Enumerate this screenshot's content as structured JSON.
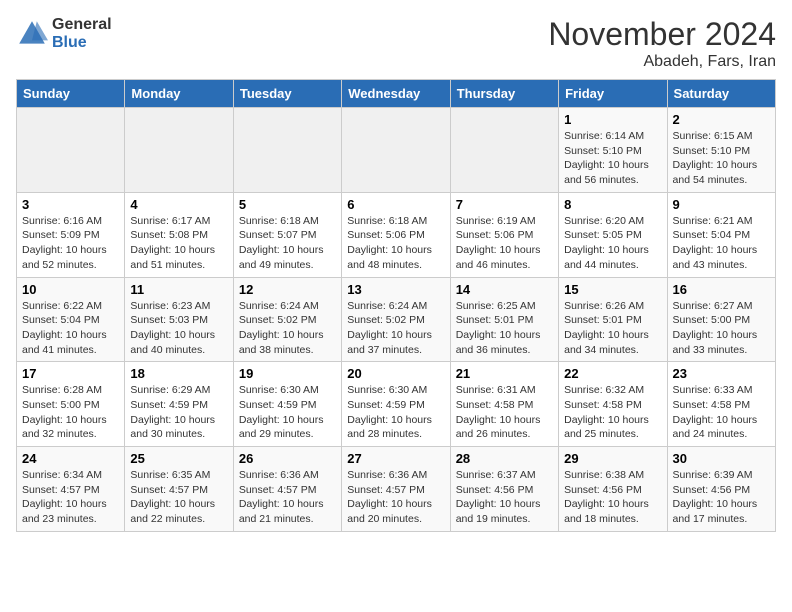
{
  "header": {
    "logo_general": "General",
    "logo_blue": "Blue",
    "month_title": "November 2024",
    "location": "Abadeh, Fars, Iran"
  },
  "days_of_week": [
    "Sunday",
    "Monday",
    "Tuesday",
    "Wednesday",
    "Thursday",
    "Friday",
    "Saturday"
  ],
  "weeks": [
    [
      {
        "day": "",
        "info": ""
      },
      {
        "day": "",
        "info": ""
      },
      {
        "day": "",
        "info": ""
      },
      {
        "day": "",
        "info": ""
      },
      {
        "day": "",
        "info": ""
      },
      {
        "day": "1",
        "info": "Sunrise: 6:14 AM\nSunset: 5:10 PM\nDaylight: 10 hours\nand 56 minutes."
      },
      {
        "day": "2",
        "info": "Sunrise: 6:15 AM\nSunset: 5:10 PM\nDaylight: 10 hours\nand 54 minutes."
      }
    ],
    [
      {
        "day": "3",
        "info": "Sunrise: 6:16 AM\nSunset: 5:09 PM\nDaylight: 10 hours\nand 52 minutes."
      },
      {
        "day": "4",
        "info": "Sunrise: 6:17 AM\nSunset: 5:08 PM\nDaylight: 10 hours\nand 51 minutes."
      },
      {
        "day": "5",
        "info": "Sunrise: 6:18 AM\nSunset: 5:07 PM\nDaylight: 10 hours\nand 49 minutes."
      },
      {
        "day": "6",
        "info": "Sunrise: 6:18 AM\nSunset: 5:06 PM\nDaylight: 10 hours\nand 48 minutes."
      },
      {
        "day": "7",
        "info": "Sunrise: 6:19 AM\nSunset: 5:06 PM\nDaylight: 10 hours\nand 46 minutes."
      },
      {
        "day": "8",
        "info": "Sunrise: 6:20 AM\nSunset: 5:05 PM\nDaylight: 10 hours\nand 44 minutes."
      },
      {
        "day": "9",
        "info": "Sunrise: 6:21 AM\nSunset: 5:04 PM\nDaylight: 10 hours\nand 43 minutes."
      }
    ],
    [
      {
        "day": "10",
        "info": "Sunrise: 6:22 AM\nSunset: 5:04 PM\nDaylight: 10 hours\nand 41 minutes."
      },
      {
        "day": "11",
        "info": "Sunrise: 6:23 AM\nSunset: 5:03 PM\nDaylight: 10 hours\nand 40 minutes."
      },
      {
        "day": "12",
        "info": "Sunrise: 6:24 AM\nSunset: 5:02 PM\nDaylight: 10 hours\nand 38 minutes."
      },
      {
        "day": "13",
        "info": "Sunrise: 6:24 AM\nSunset: 5:02 PM\nDaylight: 10 hours\nand 37 minutes."
      },
      {
        "day": "14",
        "info": "Sunrise: 6:25 AM\nSunset: 5:01 PM\nDaylight: 10 hours\nand 36 minutes."
      },
      {
        "day": "15",
        "info": "Sunrise: 6:26 AM\nSunset: 5:01 PM\nDaylight: 10 hours\nand 34 minutes."
      },
      {
        "day": "16",
        "info": "Sunrise: 6:27 AM\nSunset: 5:00 PM\nDaylight: 10 hours\nand 33 minutes."
      }
    ],
    [
      {
        "day": "17",
        "info": "Sunrise: 6:28 AM\nSunset: 5:00 PM\nDaylight: 10 hours\nand 32 minutes."
      },
      {
        "day": "18",
        "info": "Sunrise: 6:29 AM\nSunset: 4:59 PM\nDaylight: 10 hours\nand 30 minutes."
      },
      {
        "day": "19",
        "info": "Sunrise: 6:30 AM\nSunset: 4:59 PM\nDaylight: 10 hours\nand 29 minutes."
      },
      {
        "day": "20",
        "info": "Sunrise: 6:30 AM\nSunset: 4:59 PM\nDaylight: 10 hours\nand 28 minutes."
      },
      {
        "day": "21",
        "info": "Sunrise: 6:31 AM\nSunset: 4:58 PM\nDaylight: 10 hours\nand 26 minutes."
      },
      {
        "day": "22",
        "info": "Sunrise: 6:32 AM\nSunset: 4:58 PM\nDaylight: 10 hours\nand 25 minutes."
      },
      {
        "day": "23",
        "info": "Sunrise: 6:33 AM\nSunset: 4:58 PM\nDaylight: 10 hours\nand 24 minutes."
      }
    ],
    [
      {
        "day": "24",
        "info": "Sunrise: 6:34 AM\nSunset: 4:57 PM\nDaylight: 10 hours\nand 23 minutes."
      },
      {
        "day": "25",
        "info": "Sunrise: 6:35 AM\nSunset: 4:57 PM\nDaylight: 10 hours\nand 22 minutes."
      },
      {
        "day": "26",
        "info": "Sunrise: 6:36 AM\nSunset: 4:57 PM\nDaylight: 10 hours\nand 21 minutes."
      },
      {
        "day": "27",
        "info": "Sunrise: 6:36 AM\nSunset: 4:57 PM\nDaylight: 10 hours\nand 20 minutes."
      },
      {
        "day": "28",
        "info": "Sunrise: 6:37 AM\nSunset: 4:56 PM\nDaylight: 10 hours\nand 19 minutes."
      },
      {
        "day": "29",
        "info": "Sunrise: 6:38 AM\nSunset: 4:56 PM\nDaylight: 10 hours\nand 18 minutes."
      },
      {
        "day": "30",
        "info": "Sunrise: 6:39 AM\nSunset: 4:56 PM\nDaylight: 10 hours\nand 17 minutes."
      }
    ]
  ]
}
